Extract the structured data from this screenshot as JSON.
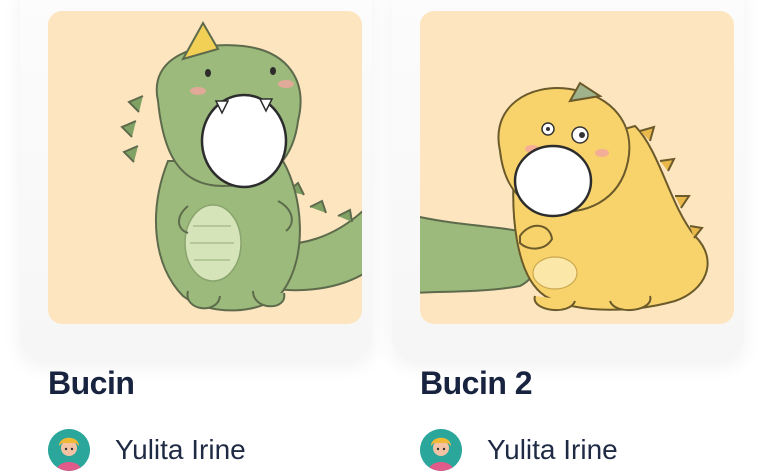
{
  "cards": [
    {
      "title": "Bucin",
      "image_icon": "green-dinosaur-illustration",
      "author": {
        "name": "Yulita Irine",
        "avatar_icon": "avatar-icon"
      }
    },
    {
      "title": "Bucin 2",
      "image_icon": "yellow-dinosaur-illustration",
      "author": {
        "name": "Yulita Irine",
        "avatar_icon": "avatar-icon"
      }
    }
  ],
  "colors": {
    "thumbnail_bg": "#fde5bf",
    "title_text": "#17233f",
    "green_dino": "#9cba7b",
    "yellow_dino": "#f8d26b"
  }
}
